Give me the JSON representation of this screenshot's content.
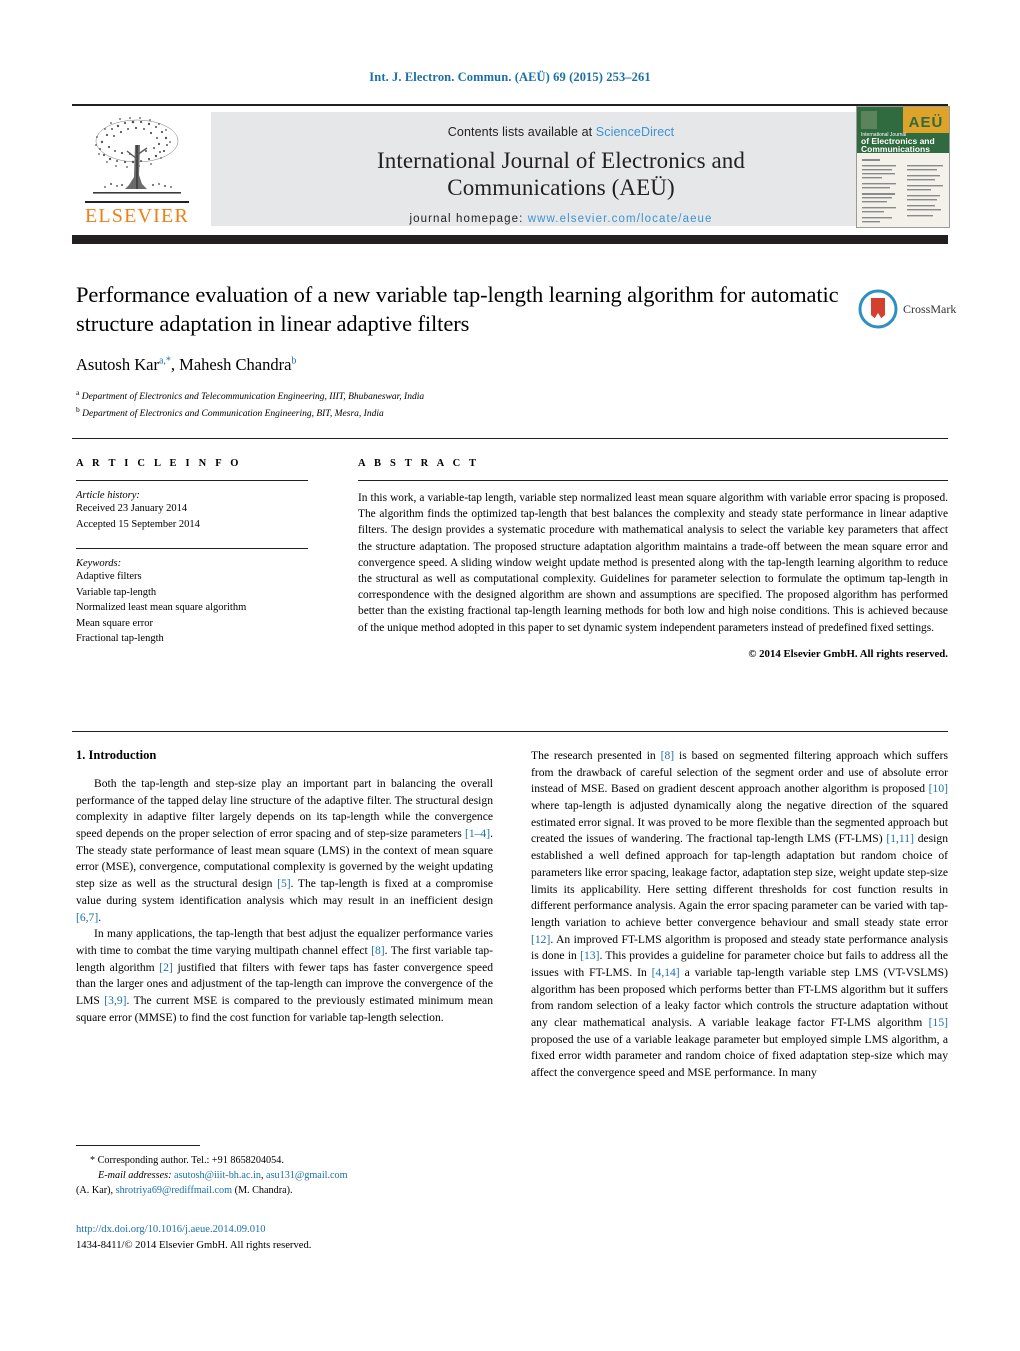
{
  "running_head": "Int. J. Electron. Commun. (AEÜ) 69 (2015) 253–261",
  "header": {
    "publisher_name": "ELSEVIER",
    "contents_prefix": "Contents lists available at ",
    "contents_link": "ScienceDirect",
    "journal_title_line1": "International Journal of Electronics and",
    "journal_title_line2": "Communications (AEÜ)",
    "homepage_prefix": "journal homepage: ",
    "homepage_url": "www.elsevier.com/locate/aeue",
    "cover_title_line1": "International Journal",
    "cover_title_line2": "of Electronics and",
    "cover_title_line3": "Communications",
    "cover_mark": "AEÜ"
  },
  "article": {
    "title": "Performance evaluation of a new variable tap-length learning algorithm for automatic structure adaptation in linear adaptive filters",
    "authors_html": "Asutosh Kar<sup>a,*</sup>, Mahesh Chandra<sup>b</sup>",
    "affiliation_a": "Department of Electronics and Telecommunication Engineering, IIIT, Bhubaneswar, India",
    "affiliation_b": "Department of Electronics and Communication Engineering, BIT, Mesra, India",
    "crossmark_label": "CrossMark"
  },
  "article_info": {
    "heading": "A R T I C L E   I N F O",
    "history_label": "Article history:",
    "received": "Received 23 January 2014",
    "accepted": "Accepted 15 September 2014",
    "keywords_label": "Keywords:",
    "keywords": [
      "Adaptive filters",
      "Variable tap-length",
      "Normalized least mean square algorithm",
      "Mean square error",
      "Fractional tap-length"
    ]
  },
  "abstract": {
    "heading": "A B S T R A C T",
    "text": "In this work, a variable-tap length, variable step normalized least mean square algorithm with variable error spacing is proposed. The algorithm finds the optimized tap-length that best balances the complexity and steady state performance in linear adaptive filters. The design provides a systematic procedure with mathematical analysis to select the variable key parameters that affect the structure adaptation. The proposed structure adaptation algorithm maintains a trade-off between the mean square error and convergence speed. A sliding window weight update method is presented along with the tap-length learning algorithm to reduce the structural as well as computational complexity. Guidelines for parameter selection to formulate the optimum tap-length in correspondence with the designed algorithm are shown and assumptions are specified. The proposed algorithm has performed better than the existing fractional tap-length learning methods for both low and high noise conditions. This is achieved because of the unique method adopted in this paper to set dynamic system independent parameters instead of predefined fixed settings.",
    "copyright": "© 2014 Elsevier GmbH. All rights reserved."
  },
  "body": {
    "section_number_title": "1.  Introduction",
    "left_paragraphs": [
      "Both the tap-length and step-size play an important part in balancing the overall performance of the tapped delay line structure of the adaptive filter. The structural design complexity in adaptive filter largely depends on its tap-length while the convergence speed depends on the proper selection of error spacing and of step-size parameters [1–4]. The steady state performance of least mean square (LMS) in the context of mean square error (MSE), convergence, computational complexity is governed by the weight updating step size as well as the structural design [5]. The tap-length is fixed at a compromise value during system identification analysis which may result in an inefficient design [6,7].",
      "In many applications, the tap-length that best adjust the equalizer performance varies with time to combat the time varying multipath channel effect [8]. The first variable tap-length algorithm [2] justified that filters with fewer taps has faster convergence speed than the larger ones and adjustment of the tap-length can improve the convergence of the LMS [3,9]. The current MSE is compared to the previously estimated minimum mean square error (MMSE) to find the cost function for variable tap-length selection."
    ],
    "right_paragraphs": [
      "The research presented in [8] is based on segmented filtering approach which suffers from the drawback of careful selection of the segment order and use of absolute error instead of MSE. Based on gradient descent approach another algorithm is proposed [10] where tap-length is adjusted dynamically along the negative direction of the squared estimated error signal. It was proved to be more flexible than the segmented approach but created the issues of wandering. The fractional tap-length LMS (FT-LMS) [1,11] design established a well defined approach for tap-length adaptation but random choice of parameters like error spacing, leakage factor, adaptation step size, weight update step-size limits its applicability. Here setting different thresholds for cost function results in different performance analysis. Again the error spacing parameter can be varied with tap-length variation to achieve better convergence behaviour and small steady state error [12]. An improved FT-LMS algorithm is proposed and steady state performance analysis is done in [13]. This provides a guideline for parameter choice but fails to address all the issues with FT-LMS. In [4,14] a variable tap-length variable step LMS (VT-VSLMS) algorithm has been proposed which performs better than FT-LMS algorithm but it suffers from random selection of a leaky factor which controls the structure adaptation without any clear mathematical analysis. A variable leakage factor FT-LMS algorithm [15] proposed the use of a variable leakage parameter but employed simple LMS algorithm, a fixed error width parameter and random choice of fixed adaptation step-size which may affect the convergence speed and MSE performance. In many"
    ]
  },
  "footnotes": {
    "corresponding": "* Corresponding author. Tel.: +91 8658204054.",
    "email_label": "E-mail addresses:",
    "email_1": "asutosh@iiit-bh.ac.in",
    "email_2": "asu131@gmail.com",
    "email_1_owner": "(A. Kar),",
    "email_3": "shrotriya69@rediffmail.com",
    "email_3_owner": "(M. Chandra).",
    "doi": "http://dx.doi.org/10.1016/j.aeue.2014.09.010",
    "issn_line": "1434-8411/© 2014 Elsevier GmbH. All rights reserved."
  },
  "colors": {
    "link": "#1b6fa8",
    "sciencedirect": "#3c94d4",
    "elsevier_orange": "#f07f13",
    "rule_dark": "#231f20",
    "band_gray": "#e6e7e8"
  }
}
